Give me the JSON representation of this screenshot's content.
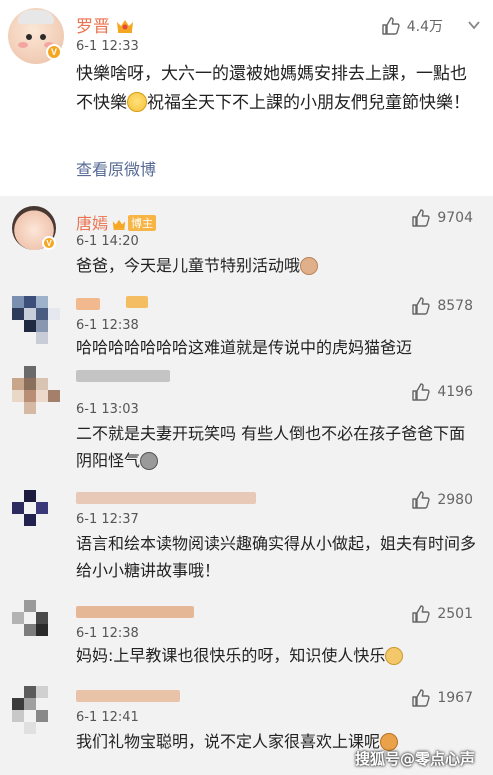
{
  "post": {
    "author": "罗晋",
    "time": "6-1 12:33",
    "likes": "4.4万",
    "text_1": "快樂啥呀，大六一的還被她媽媽安排去上課，一點也不快樂",
    "text_2": "祝福全天下不上課的小朋友們兒童節快樂！",
    "view_original": "查看原微博",
    "avatar_badge": "V"
  },
  "comments": [
    {
      "name": "唐嫣",
      "tag": "博主",
      "time": "6-1 14:20",
      "likes": "9704",
      "text": "爸爸，今天是儿童节特别活动哦",
      "avatar_badge": "V"
    },
    {
      "name": "",
      "time": "6-1 12:38",
      "likes": "8578",
      "text": "哈哈哈哈哈哈哈这难道就是传说中的虎妈猫爸迈"
    },
    {
      "name": "",
      "time": "6-1 13:03",
      "likes": "4196",
      "text": "二不就是夫妻开玩笑吗 有些人倒也不必在孩子爸爸下面阴阳怪气"
    },
    {
      "name": "",
      "time": "6-1 12:37",
      "likes": "2980",
      "text": "语言和绘本读物阅读兴趣确实得从小做起，姐夫有时间多给小小糖讲故事哦！"
    },
    {
      "name": "",
      "time": "6-1 12:38",
      "likes": "2501",
      "text": "妈妈:上早教课也很快乐的呀，知识使人快乐"
    },
    {
      "name": "",
      "time": "6-1 12:41",
      "likes": "1967",
      "text": "我们礼物宝聪明，说不定人家很喜欢上课呢"
    }
  ],
  "watermark": "搜狐号@零点心声",
  "colors": {
    "name": "#eb7350",
    "link": "#576b95",
    "background": "#f2f2f2",
    "badge": "#f5a623"
  },
  "icons": [
    "thumb-up-icon",
    "chevron-down-icon",
    "crown-icon",
    "verified-icon"
  ]
}
